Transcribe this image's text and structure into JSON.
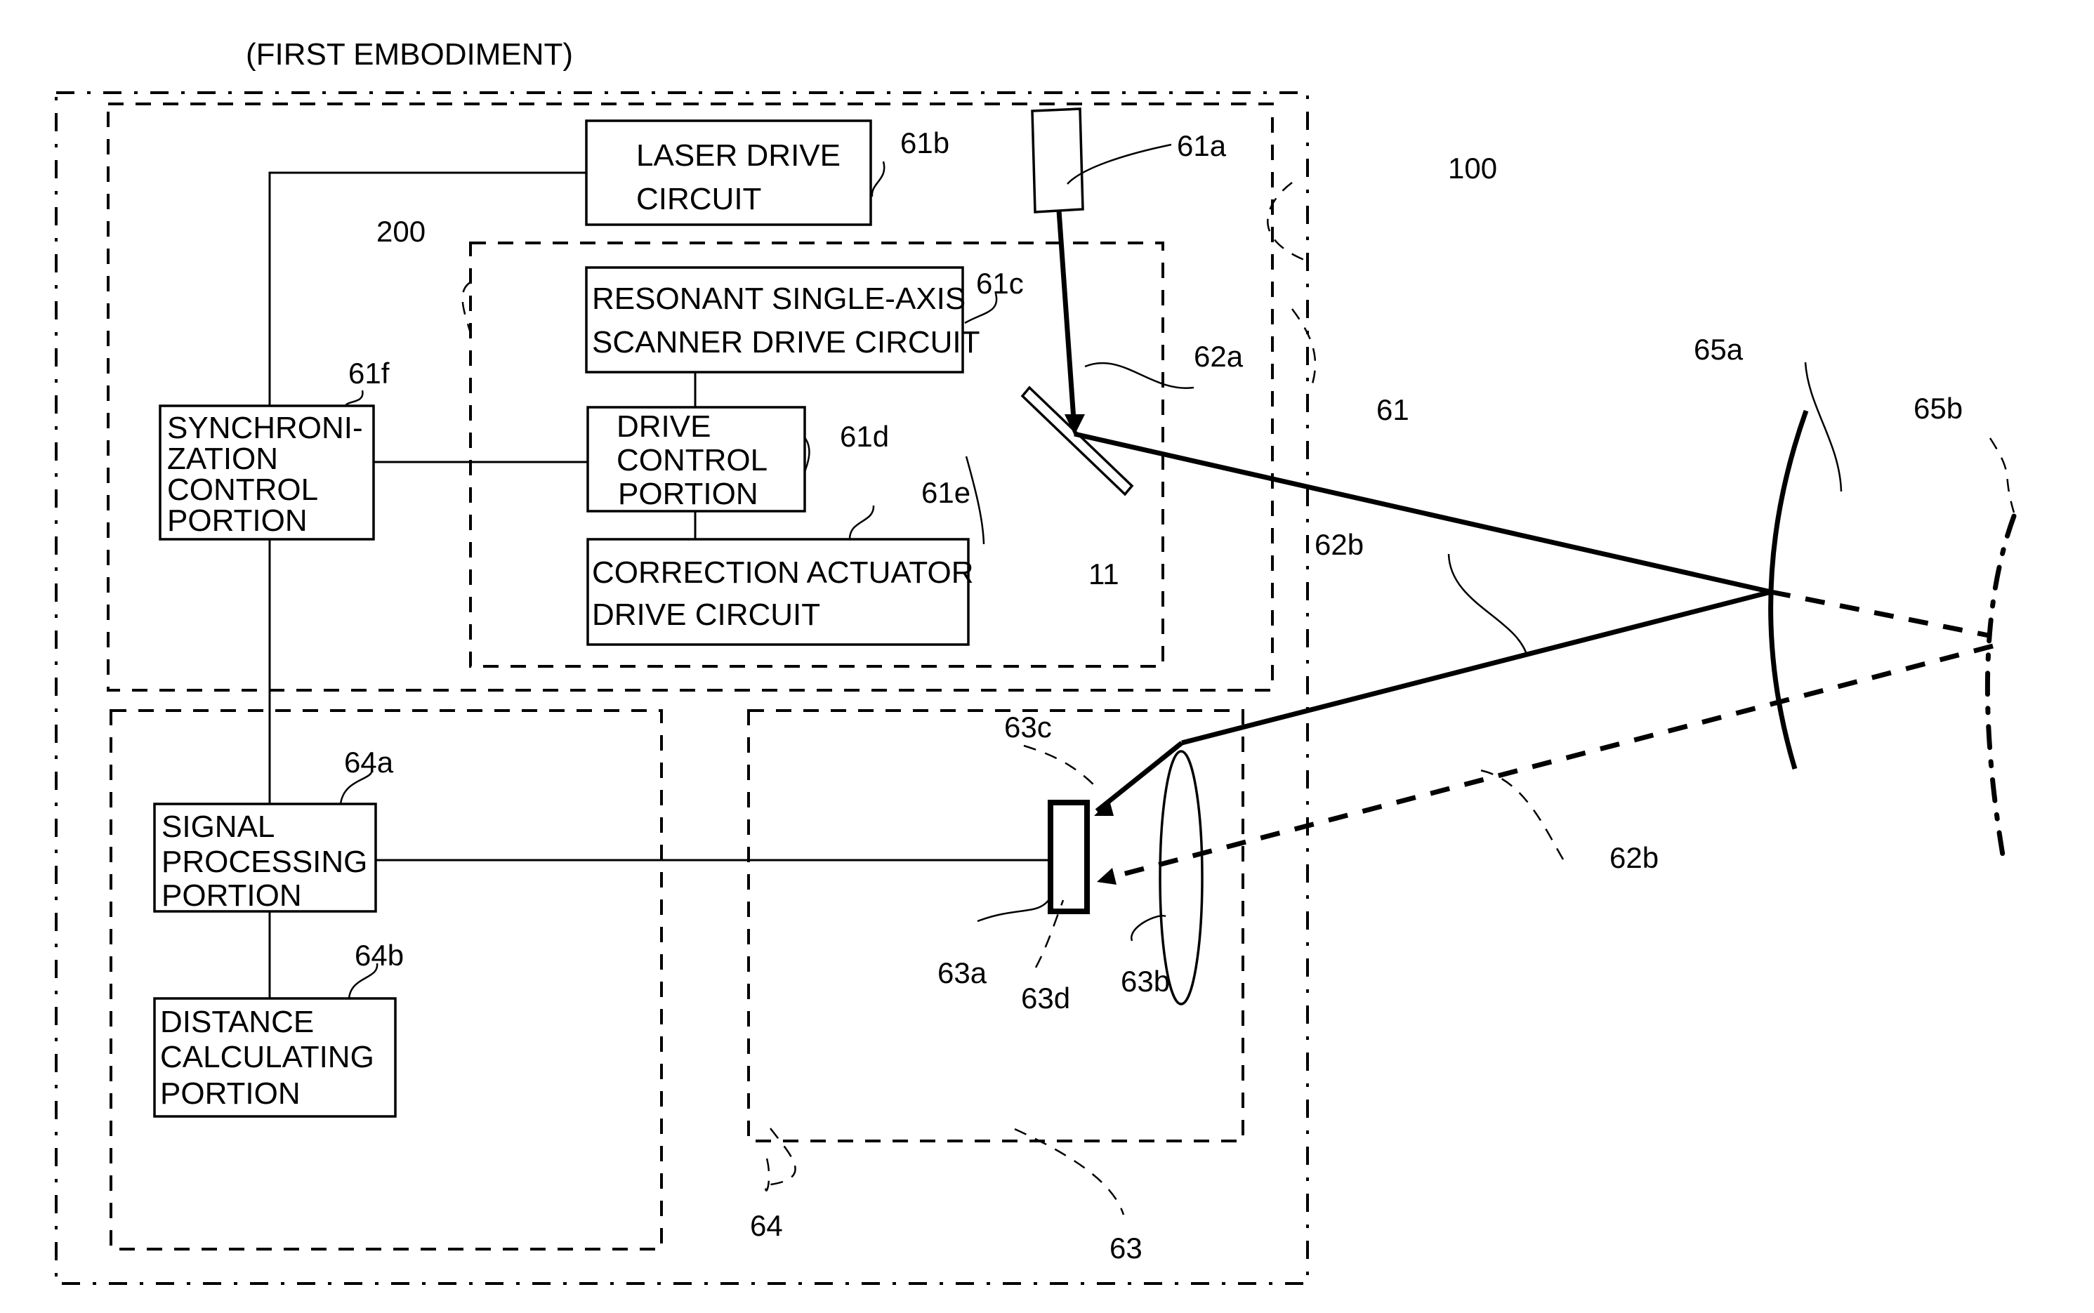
{
  "figure": {
    "title": "(FIRST EMBODIMENT)"
  },
  "blocks": {
    "laser_drive": {
      "ref": "61b",
      "lines": [
        "LASER DRIVE",
        "CIRCUIT"
      ]
    },
    "resonant_scanner": {
      "ref": "61c",
      "lines": [
        "RESONANT SINGLE-AXIS",
        "SCANNER DRIVE CIRCUIT"
      ]
    },
    "drive_control": {
      "ref": "61d",
      "lines": [
        "DRIVE",
        "CONTROL",
        "PORTION"
      ]
    },
    "correction_actuator": {
      "ref": "61e",
      "lines": [
        "CORRECTION ACTUATOR",
        "DRIVE CIRCUIT"
      ]
    },
    "synchronization": {
      "ref": "61f",
      "lines": [
        "SYNCHRONI-",
        "ZATION",
        "CONTROL",
        "PORTION"
      ]
    },
    "signal_processing": {
      "ref": "64a",
      "lines": [
        "SIGNAL",
        "PROCESSING",
        "PORTION"
      ]
    },
    "distance_calculating": {
      "ref": "64b",
      "lines": [
        "DISTANCE",
        "CALCULATING",
        "PORTION"
      ]
    }
  },
  "regions": {
    "system": "100",
    "light_projection": "61",
    "scanner_unit": "200",
    "light_receiving": "63",
    "processing": "64"
  },
  "components": {
    "light_source": "61a",
    "mirror": "11",
    "projected_beam": "62a",
    "reflected_beam": "62b",
    "reflected_beam_far": "62b",
    "detector": "63a",
    "lens": "63b",
    "spot_near": "63c",
    "spot_far": "63d",
    "target_near": "65a",
    "target_far": "65b"
  }
}
